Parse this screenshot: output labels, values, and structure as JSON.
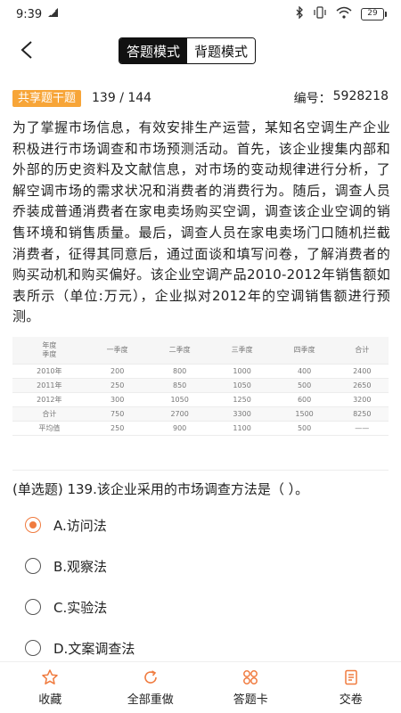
{
  "status": {
    "time": "9:39",
    "battery": "29"
  },
  "nav": {
    "tabs": [
      "答题模式",
      "背题模式"
    ],
    "active_tab": 0
  },
  "header": {
    "tag": "共享题干题",
    "progress": "139 / 144",
    "code_label": "编号：",
    "code": "5928218"
  },
  "passage": "为了掌握市场信息，有效安排生产运营，某知名空调生产企业积极进行市场调查和市场预测活动。首先，该企业搜集内部和外部的历史资料及文献信息，对市场的变动规律进行分析，了解空调市场的需求状况和消费者的消费行为。随后，调查人员乔装成普通消费者在家电卖场购买空调，调查该企业空调的销售环境和销售质量。最后，调查人员在家电卖场门口随机拦截消费者，征得其同意后，通过面谈和填写问卷，了解消费者的购买动机和购买偏好。该企业空调产品2010-2012年销售额如表所示（单位:万元），企业拟对2012年的空调销售额进行预测。",
  "table": {
    "corner_top": "年度",
    "corner_bottom": "季度",
    "headers": [
      "一季度",
      "二季度",
      "三季度",
      "四季度",
      "合计"
    ],
    "rows": [
      [
        "2010年",
        "200",
        "800",
        "1000",
        "400",
        "2400"
      ],
      [
        "2011年",
        "250",
        "850",
        "1050",
        "500",
        "2650"
      ],
      [
        "2012年",
        "300",
        "1050",
        "1250",
        "600",
        "3200"
      ],
      [
        "合计",
        "750",
        "2700",
        "3300",
        "1500",
        "8250"
      ],
      [
        "平均值",
        "250",
        "900",
        "1100",
        "500",
        "——"
      ]
    ]
  },
  "question": "(单选题) 139.该企业采用的市场调查方法是（ ）。",
  "options": [
    {
      "label": "A.访问法",
      "checked": true
    },
    {
      "label": "B.观察法",
      "checked": false
    },
    {
      "label": "C.实验法",
      "checked": false
    },
    {
      "label": "D.文案调查法",
      "checked": false
    }
  ],
  "toolbar": {
    "favorite": "收藏",
    "redo_all": "全部重做",
    "answer_card": "答题卡",
    "submit": "交卷"
  },
  "colors": {
    "accent": "#f07b3f",
    "tag": "#f7a538",
    "active_tab_bg": "#111111"
  },
  "icons": [
    "signal-icon",
    "bluetooth-icon",
    "vibrate-icon",
    "wifi-icon",
    "battery-icon",
    "back-arrow-icon",
    "star-icon",
    "refresh-icon",
    "grid-icon",
    "submit-doc-icon"
  ]
}
